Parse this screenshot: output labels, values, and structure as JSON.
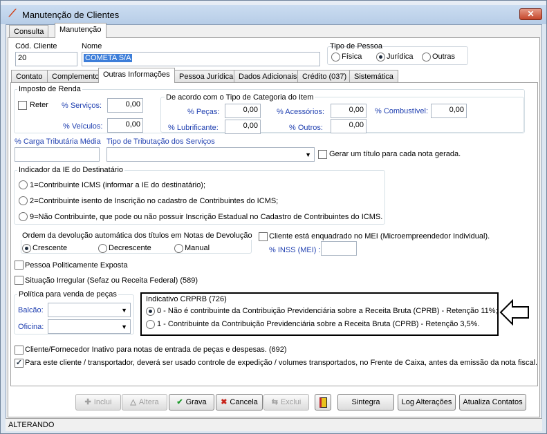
{
  "window": {
    "title": "Manutenção de Clientes",
    "close_symbol": "✕"
  },
  "main_tabs": [
    {
      "label": "Consulta"
    },
    {
      "label": "Manutenção"
    }
  ],
  "form": {
    "cod_label": "Cód. Cliente",
    "cod_value": "20",
    "nome_label": "Nome",
    "nome_value": "COMETA S/A",
    "tipo_pessoa_label": "Tipo de Pessoa",
    "tipo_pessoa_options": [
      {
        "label": "Física"
      },
      {
        "label": "Jurídica"
      },
      {
        "label": "Outras"
      }
    ],
    "tipo_pessoa_selected": "Jurídica"
  },
  "sub_tabs": [
    {
      "label": "Contato"
    },
    {
      "label": "Complemento"
    },
    {
      "label": "Outras Informações"
    },
    {
      "label": "Pessoa Jurídica"
    },
    {
      "label": "Dados Adicionais"
    },
    {
      "label": "Crédito (037)"
    },
    {
      "label": "Sistemática"
    }
  ],
  "active_sub_tab": "Outras Informações",
  "imposto": {
    "title": "Imposto de Renda",
    "reter_label": "Reter",
    "servicos_label": "% Serviços:",
    "servicos_value": "0,00",
    "veiculos_label": "% Veículos:",
    "veiculos_value": "0,00"
  },
  "categoria": {
    "title": "De acordo com o Tipo de Categoria do Item",
    "pecas_label": "% Peças:",
    "pecas_value": "0,00",
    "lubrificante_label": "% Lubrificante:",
    "lubrificante_value": "0,00",
    "acessorios_label": "% Acessórios:",
    "acessorios_value": "0,00",
    "outros_label": "% Outros:",
    "outros_value": "0,00",
    "combustivel_label": "% Combustível:",
    "combustivel_value": "0,00"
  },
  "carga_label": "% Carga Tributária Média",
  "tributacao_label": "Tipo de Tributação dos Serviços",
  "gerar_titulo_label": "Gerar um título para cada nota gerada.",
  "ie": {
    "title": "Indicador da IE do Destinatário",
    "options": [
      {
        "label": "1=Contribuinte ICMS (informar a IE do destinatário);"
      },
      {
        "label": "2=Contribuinte isento de Inscrição no cadastro de Contribuintes do ICMS;"
      },
      {
        "label": "9=Não Contribuinte, que pode ou não possuir Inscrição Estadual no Cadastro de Contribuintes do ICMS."
      }
    ]
  },
  "devolucao": {
    "title": "Ordem da devolução automática dos títulos em Notas de Devolução",
    "options": [
      {
        "label": "Crescente"
      },
      {
        "label": "Decrescente"
      },
      {
        "label": "Manual"
      }
    ],
    "selected": "Crescente"
  },
  "mei": {
    "label": "Cliente está enquadrado no MEI (Microempreendedor Individual).",
    "inss_label": "% INSS (MEI) :"
  },
  "pessoa_politicamente_label": "Pessoa Politicamente Exposta",
  "situacao_irregular_label": "Situação Irregular (Sefaz ou Receita Federal) (589)",
  "politica": {
    "title": "Política para venda de peças",
    "balcao_label": "Balcão:",
    "oficina_label": "Oficina:"
  },
  "crprb": {
    "title": "Indicativo CRPRB (726)",
    "options": [
      {
        "label": "0 - Não é contribuinte da Contribuição Previdenciária sobre a Receita Bruta (CPRB) - Retenção 11%;"
      },
      {
        "label": "1 - Contribuinte da Contribuição Previdenciária sobre a Receita Bruta (CPRB) - Retenção 3,5%."
      }
    ],
    "selected_index": 0
  },
  "cliente_inativo_label": "Cliente/Fornecedor Inativo para notas de entrada de peças e despesas. (692)",
  "controle_expedicao_label": "Para este cliente / transportador, deverá ser usado controle de expedição / volumes transportados, no Frente de Caixa, antes da emissão da nota fiscal.",
  "controle_expedicao_checked": true,
  "buttons": {
    "inclui": "Inclui",
    "altera": "Altera",
    "grava": "Grava",
    "cancela": "Cancela",
    "exclui": "Exclui",
    "sintegra": "Sintegra",
    "log": "Log Alterações",
    "atualiza": "Atualiza Contatos"
  },
  "status_text": "ALTERANDO",
  "colors": {
    "label_blue": "#1f3fb0",
    "highlight": "#3d7ed9",
    "callout_border": "#000000"
  }
}
